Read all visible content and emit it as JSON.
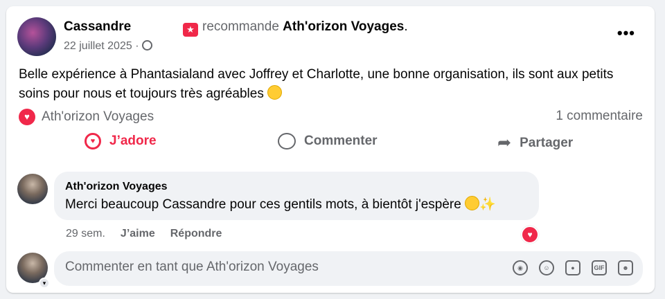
{
  "post": {
    "author": "Cassandre",
    "recommend_verb": "recommande",
    "page_name": "Ath'orizon Voyages",
    "page_suffix": ".",
    "date": "22 juillet 2025 ·",
    "more_label": "•••",
    "text": "Belle expérience à Phantasialand avec Joffrey et Charlotte, une bonne organisation, ils sont aux petits soins pour nous et toujours très agréables"
  },
  "reactions": {
    "by": "Ath'orizon Voyages",
    "comment_count": "1 commentaire"
  },
  "actions": {
    "love": "J’adore",
    "comment": "Commenter",
    "share": "Partager"
  },
  "comment": {
    "author": "Ath'orizon Voyages",
    "text": "Merci beaucoup Cassandre pour ces gentils mots, à bientôt j'espère",
    "time": "29 sem.",
    "like": "J’aime",
    "reply": "Répondre"
  },
  "composer": {
    "placeholder": "Commenter en tant que Ath'orizon Voyages",
    "tools": [
      "avatar-sticker-icon",
      "emoji-icon",
      "camera-icon",
      "gif-icon",
      "sticker-icon"
    ]
  },
  "colors": {
    "love_red": "#f0284a",
    "secondary_text": "#65676b",
    "bubble_bg": "#f0f2f5"
  }
}
